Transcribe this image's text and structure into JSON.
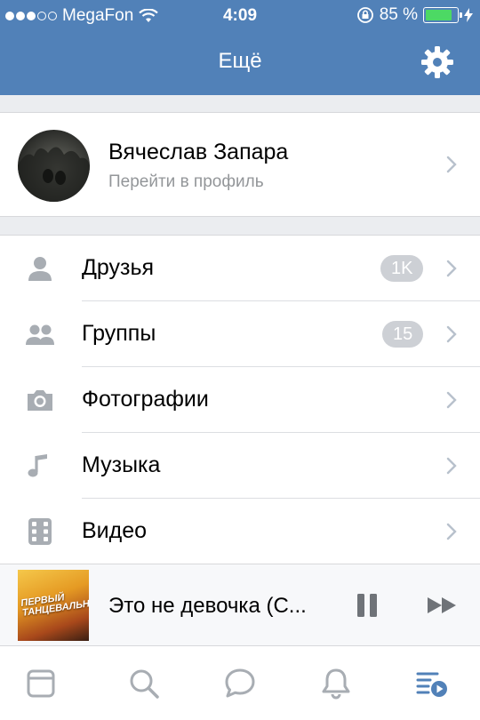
{
  "status_bar": {
    "carrier": "MegaFon",
    "time": "4:09",
    "battery_percent": "85 %",
    "battery_level": 0.85,
    "signal_bars_filled": 3,
    "signal_bars_total": 5
  },
  "nav": {
    "title": "Ещё",
    "settings_icon": "gear-icon"
  },
  "profile": {
    "name": "Вячеслав Запара",
    "subtitle": "Перейти в профиль"
  },
  "menu": {
    "items": [
      {
        "label": "Друзья",
        "icon": "person-icon",
        "badge": "1K"
      },
      {
        "label": "Группы",
        "icon": "people-icon",
        "badge": "15"
      },
      {
        "label": "Фотографии",
        "icon": "camera-icon",
        "badge": ""
      },
      {
        "label": "Музыка",
        "icon": "music-note-icon",
        "badge": ""
      },
      {
        "label": "Видео",
        "icon": "film-icon",
        "badge": ""
      }
    ]
  },
  "player": {
    "track": "Это не девочка (C...",
    "cover_text": "ПЕРВЫЙ ТАНЦЕВАЛЬНЫЙ"
  },
  "tabbar": {
    "tabs": [
      "news-icon",
      "search-icon",
      "messages-icon",
      "notifications-icon",
      "more-icon"
    ],
    "active_tab": "more-icon"
  },
  "colors": {
    "accent": "#5181b8",
    "icon_gray": "#a8adb3",
    "badge_gray": "#cdd0d5",
    "battery_green": "#4cd964"
  }
}
